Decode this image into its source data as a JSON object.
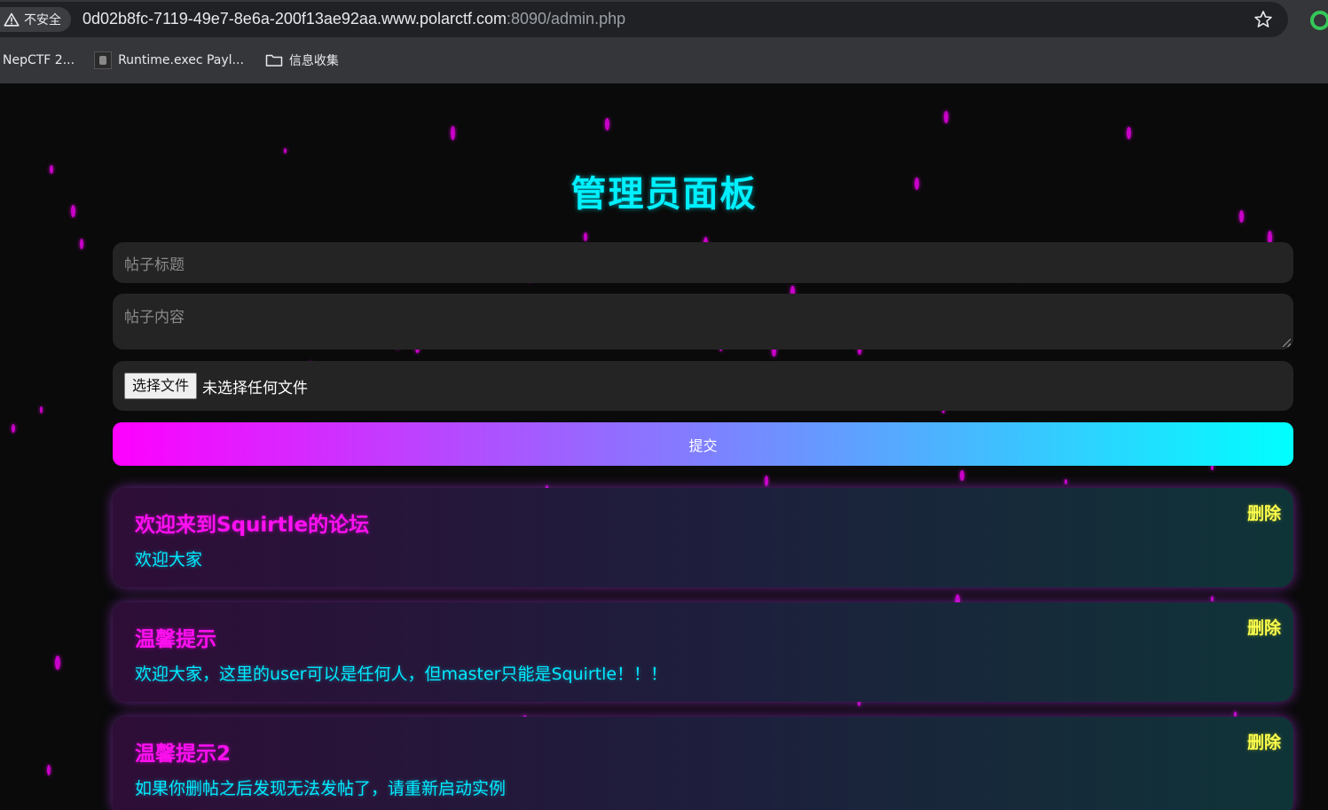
{
  "browser": {
    "security_label": "不安全",
    "url_host_main": "0d02b8fc-7119-49e7-8e6a-200f13ae92aa.www.polarctf.com",
    "url_path": ":8090/admin.php",
    "bookmarks": [
      {
        "label": "NepCTF 2..."
      },
      {
        "label": "Runtime.exec Payl..."
      },
      {
        "label": "信息收集"
      }
    ]
  },
  "page": {
    "title": "管理员面板",
    "form": {
      "title_placeholder": "帖子标题",
      "content_placeholder": "帖子内容",
      "file_button": "选择文件",
      "file_status": "未选择任何文件",
      "submit_label": "提交"
    },
    "posts": [
      {
        "title": "欢迎来到Squirtle的论坛",
        "body": "欢迎大家",
        "delete_label": "删除"
      },
      {
        "title": "温馨提示",
        "body": "欢迎大家，这里的user可以是任何人，但master只能是Squirtle！！！",
        "delete_label": "删除"
      },
      {
        "title": "温馨提示2",
        "body": "如果你删帖之后发现无法发帖了，请重新启动实例",
        "delete_label": "删除"
      }
    ]
  },
  "colors": {
    "title": "#00f0ff",
    "post_title": "#ff10f0",
    "post_body": "#00eaff",
    "delete": "#ffff4d",
    "gradient_start": "#ff00ff",
    "gradient_end": "#00ffff",
    "drops": "#c800c8"
  }
}
